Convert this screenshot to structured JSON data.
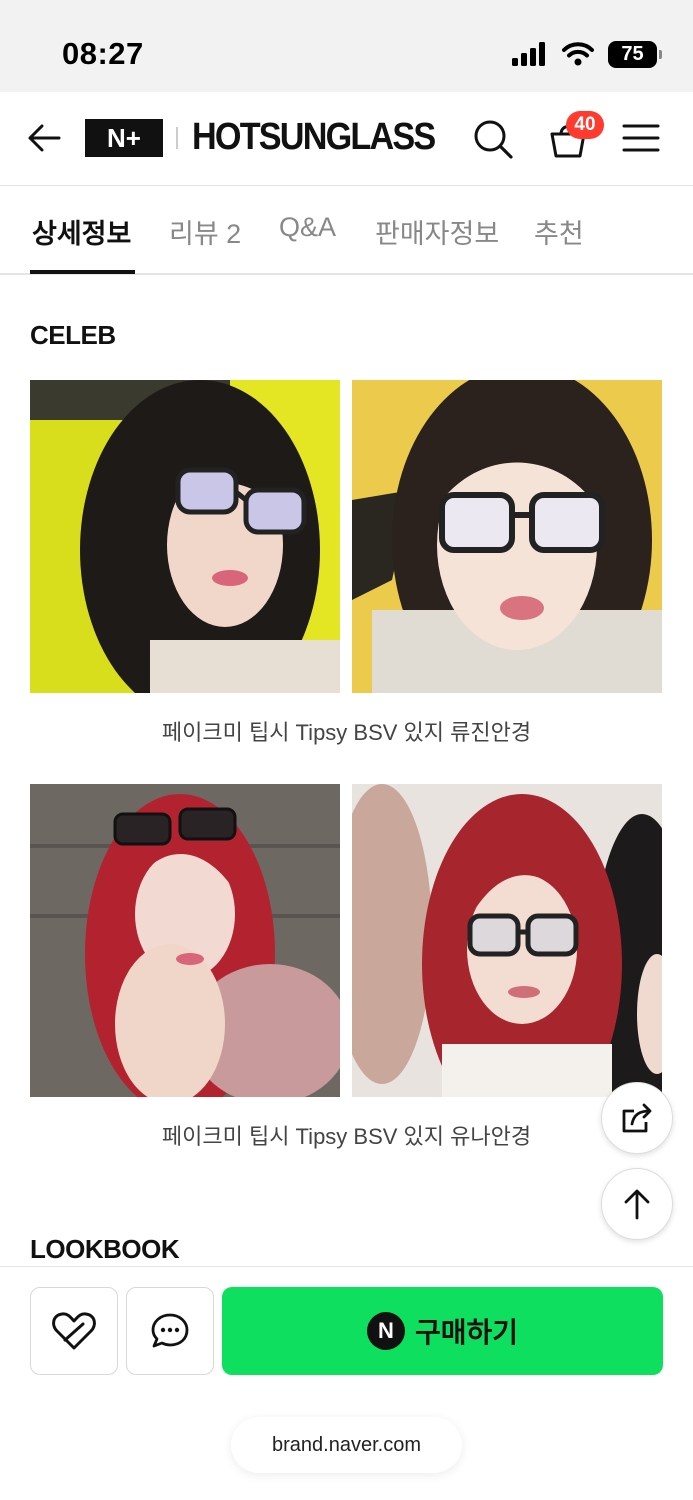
{
  "status_bar": {
    "time": "08:27",
    "battery": "75"
  },
  "header": {
    "brand_logo": "N+",
    "brand_name": "HOTSUNGLASS",
    "cart_count": "40"
  },
  "tabs": [
    {
      "label": "상세정보",
      "active": true
    },
    {
      "label": "리뷰 2",
      "active": false
    },
    {
      "label": "Q&A",
      "active": false
    },
    {
      "label": "판매자정보",
      "active": false
    },
    {
      "label": "추천",
      "active": false
    }
  ],
  "content": {
    "section_celeb": "CELEB",
    "caption_1": "페이크미 팁시 Tipsy BSV 있지 류진안경",
    "caption_2": "페이크미 팁시 Tipsy BSV 있지 유나안경",
    "section_lookbook": "LOOKBOOK"
  },
  "bottom_bar": {
    "buy_icon": "N",
    "buy_label": "구매하기",
    "url": "brand.naver.com"
  },
  "colors": {
    "buy_green": "#0fdf5f",
    "badge_red": "#ff3b30"
  }
}
